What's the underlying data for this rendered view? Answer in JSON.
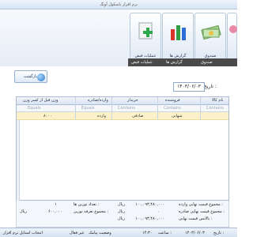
{
  "window": {
    "title": "نرم افزار باسکول آونگ"
  },
  "ribbon": {
    "tabs": [
      {
        "label": "عملیات قبض",
        "icon": "add-document-icon"
      },
      {
        "label": "گزارش ها",
        "icon": "bar-chart-icon"
      },
      {
        "label": "صندوق",
        "icon": "money-icon"
      },
      {
        "label": "ها",
        "icon": "users-icon"
      }
    ],
    "strip_labels": [
      "عملیات قبض",
      "گزارش ها",
      "صندوق"
    ]
  },
  "toolbar": {
    "back_label": "بازگشت",
    "date_label": "تاریخ :",
    "date_value": "۱۴۰۳/۰۶/۰۳"
  },
  "grid": {
    "columns": [
      "نام کالا",
      "فروشنده",
      "خریدار",
      "وارده/صادره",
      "وزن قبل از کسر وزن"
    ],
    "filters": [
      "Contains",
      "Contains",
      "Contains",
      "Equals",
      "Equals"
    ],
    "rows": [
      {
        "kala": "",
        "forushande": "شهابی",
        "kharidar": "صادقی",
        "type": "وارده",
        "weight": "۸۰۰۰"
      }
    ]
  },
  "footer": {
    "total_net_kg_label": "مجموع قیمت نهایی وارده :",
    "total_net_kg_value": "۱۰۰,۰۹۳,۴۸۰,۰۰۰",
    "unit1": "ریال",
    "total_out_label": "مجموع قیمت نهایی صادره :",
    "total_out_value": "۰",
    "unit2": "ریال",
    "balance_label": "بالانس قیمت نهایی :",
    "balance_value": "۱۰۰,۰۹۳,۴۸۰,۰۰۰",
    "unit3": "ریال",
    "count_label": "تعداد توزین ها :",
    "count_value": "۱",
    "fee_label": "مجموع تعرفه توزین :",
    "fee_value": "۶۰۰,۰۰۰",
    "unit4": "ریال"
  },
  "status": {
    "app_select": "انتخاب استایل نرم افزار",
    "inactive": "غیر فعال",
    "sms_label": "وضعیت پیامک",
    "time": "۱۴:۳۰",
    "time_label": "ساعت :",
    "date": "۱۴۰۳/۰۶/۰۳",
    "date_label": "تاریخ :"
  }
}
